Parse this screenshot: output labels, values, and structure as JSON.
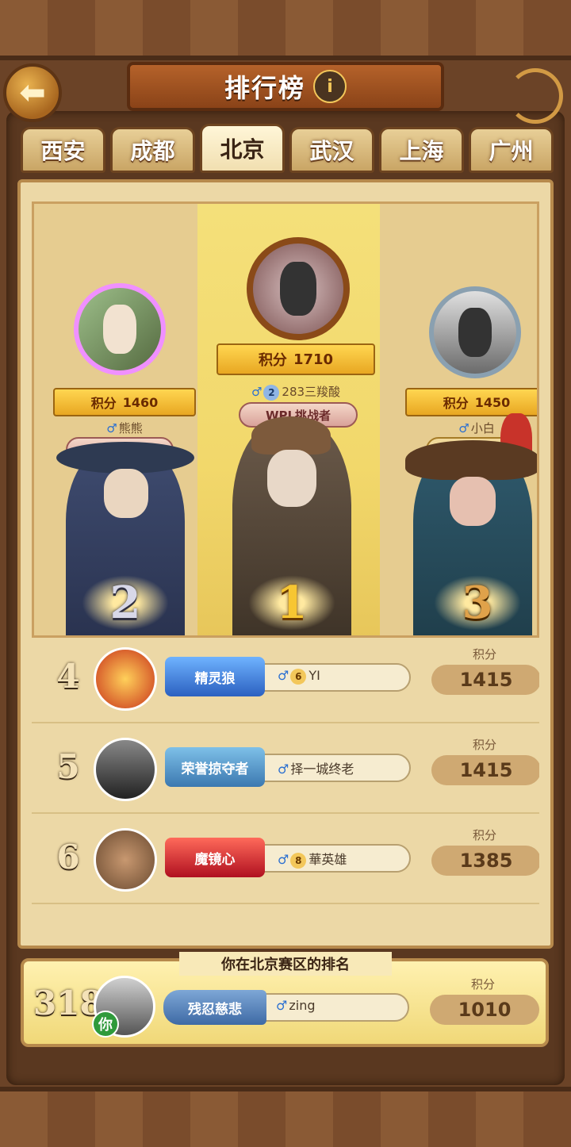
{
  "header": {
    "title": "排行榜",
    "info_icon": "i"
  },
  "tabs": [
    "西安",
    "成都",
    "北京",
    "武汉",
    "上海",
    "广州"
  ],
  "active_tab": "北京",
  "podium": {
    "first": {
      "rank": "1",
      "score_label": "积分",
      "score": "1710",
      "level": "2",
      "name": "283三羧酸",
      "tag": "WPL挑战者"
    },
    "second": {
      "rank": "2",
      "score_label": "积分",
      "score": "1460",
      "name": "熊熊",
      "tag": "WPL挑战者"
    },
    "third": {
      "rank": "3",
      "score_label": "积分",
      "score": "1450",
      "name": "小白",
      "tag": "自证清白"
    }
  },
  "rows": [
    {
      "rank": "4",
      "badge": "精灵狼",
      "level": "6",
      "name": "YI",
      "points_label": "积分",
      "points": "1415",
      "badge_color": "#3b7fd6"
    },
    {
      "rank": "5",
      "badge": "荣誉掠夺者",
      "level": "",
      "name": "择一城终老",
      "points_label": "积分",
      "points": "1415",
      "badge_color": "#3f7bb8"
    },
    {
      "rank": "6",
      "badge": "魔镜心",
      "level": "8",
      "name": "華英雄",
      "points_label": "积分",
      "points": "1385",
      "badge_color": "#c0202a"
    }
  ],
  "my_rank": {
    "title": "你在北京赛区的排名",
    "rank": "318",
    "you_label": "你",
    "badge": "残忍慈悲",
    "name": "zing",
    "points_label": "积分",
    "points": "1010"
  },
  "gender_symbol": "♂",
  "back_icon": "back-arrow-icon"
}
